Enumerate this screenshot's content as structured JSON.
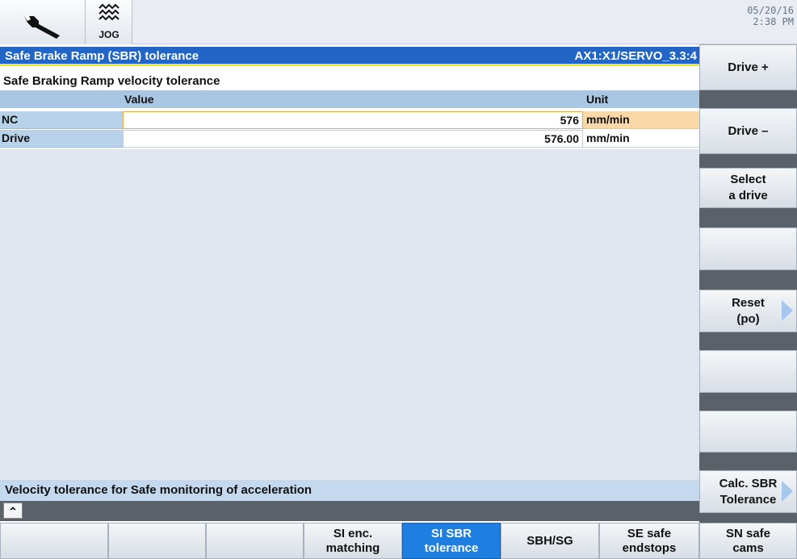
{
  "topbar": {
    "date": "05/20/16",
    "time": "2:38 PM",
    "mode_label": "JOG"
  },
  "title": {
    "left": "Safe Brake Ramp (SBR) tolerance",
    "right": "AX1:X1/SERVO_3.3:4"
  },
  "subtitle": "Safe Braking Ramp velocity tolerance",
  "table": {
    "headers": {
      "value": "Value",
      "unit": "Unit"
    },
    "rows": [
      {
        "label": "NC",
        "value": "576",
        "unit": "mm/min"
      },
      {
        "label": "Drive",
        "value": "576.00",
        "unit": "mm/min"
      }
    ]
  },
  "hint": "Velocity tolerance for Safe monitoring of acceleration",
  "vertical_softkeys": [
    {
      "line1": "Drive +",
      "line2": ""
    },
    {
      "line1": "Drive –",
      "line2": ""
    },
    {
      "line1": "Select",
      "line2": "a drive"
    },
    {
      "line1": "",
      "line2": ""
    },
    {
      "line1": "Reset",
      "line2": "(po)"
    },
    {
      "line1": "",
      "line2": ""
    },
    {
      "line1": "",
      "line2": ""
    },
    {
      "line1": "Calc. SBR",
      "line2": "Tolerance"
    }
  ],
  "horizontal_softkeys": [
    {
      "line1": "",
      "line2": ""
    },
    {
      "line1": "",
      "line2": ""
    },
    {
      "line1": "",
      "line2": ""
    },
    {
      "line1": "SI enc.",
      "line2": "matching"
    },
    {
      "line1": "SI SBR",
      "line2": "tolerance"
    },
    {
      "line1": "SBH/SG",
      "line2": ""
    },
    {
      "line1": "SE safe",
      "line2": "endstops"
    },
    {
      "line1": "SN safe",
      "line2": "cams"
    }
  ],
  "colors": {
    "title_bg": "#2166c6",
    "accent_yellow": "#f5e61a",
    "active_key": "#1e7fe0",
    "selected_unit": "#fbd8a8"
  }
}
